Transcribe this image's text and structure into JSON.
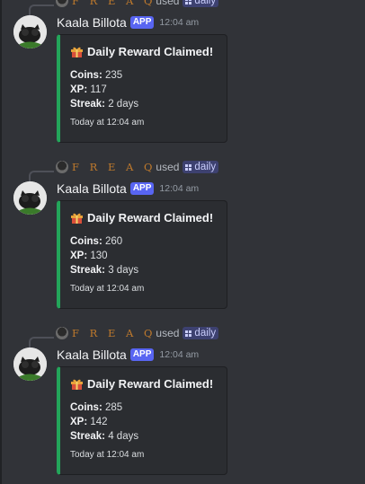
{
  "messages": [
    {
      "reply_user": "F R E A Q",
      "used_text": "used",
      "command": "daily",
      "bot_name": "Kaala Billota",
      "app_badge": "APP",
      "time": "12:04 am",
      "embed": {
        "title": "Daily Reward Claimed!",
        "fields": [
          {
            "label": "Coins:",
            "value": "235"
          },
          {
            "label": "XP:",
            "value": "117"
          },
          {
            "label": "Streak:",
            "value": "2 days"
          }
        ],
        "footer": "Today at 12:04 am",
        "accent_color": "#23a55a"
      }
    },
    {
      "reply_user": "F R E A Q",
      "used_text": "used",
      "command": "daily",
      "bot_name": "Kaala Billota",
      "app_badge": "APP",
      "time": "12:04 am",
      "embed": {
        "title": "Daily Reward Claimed!",
        "fields": [
          {
            "label": "Coins:",
            "value": "260"
          },
          {
            "label": "XP:",
            "value": "130"
          },
          {
            "label": "Streak:",
            "value": "3 days"
          }
        ],
        "footer": "Today at 12:04 am",
        "accent_color": "#23a55a"
      }
    },
    {
      "reply_user": "F R E A Q",
      "used_text": "used",
      "command": "daily",
      "bot_name": "Kaala Billota",
      "app_badge": "APP",
      "time": "12:04 am",
      "embed": {
        "title": "Daily Reward Claimed!",
        "fields": [
          {
            "label": "Coins:",
            "value": "285"
          },
          {
            "label": "XP:",
            "value": "142"
          },
          {
            "label": "Streak:",
            "value": "4 days"
          }
        ],
        "footer": "Today at 12:04 am",
        "accent_color": "#23a55a"
      }
    }
  ],
  "icons": {
    "gift": "gift-icon",
    "command": "slash-command-icon",
    "avatar": "cat-avatar-icon"
  }
}
